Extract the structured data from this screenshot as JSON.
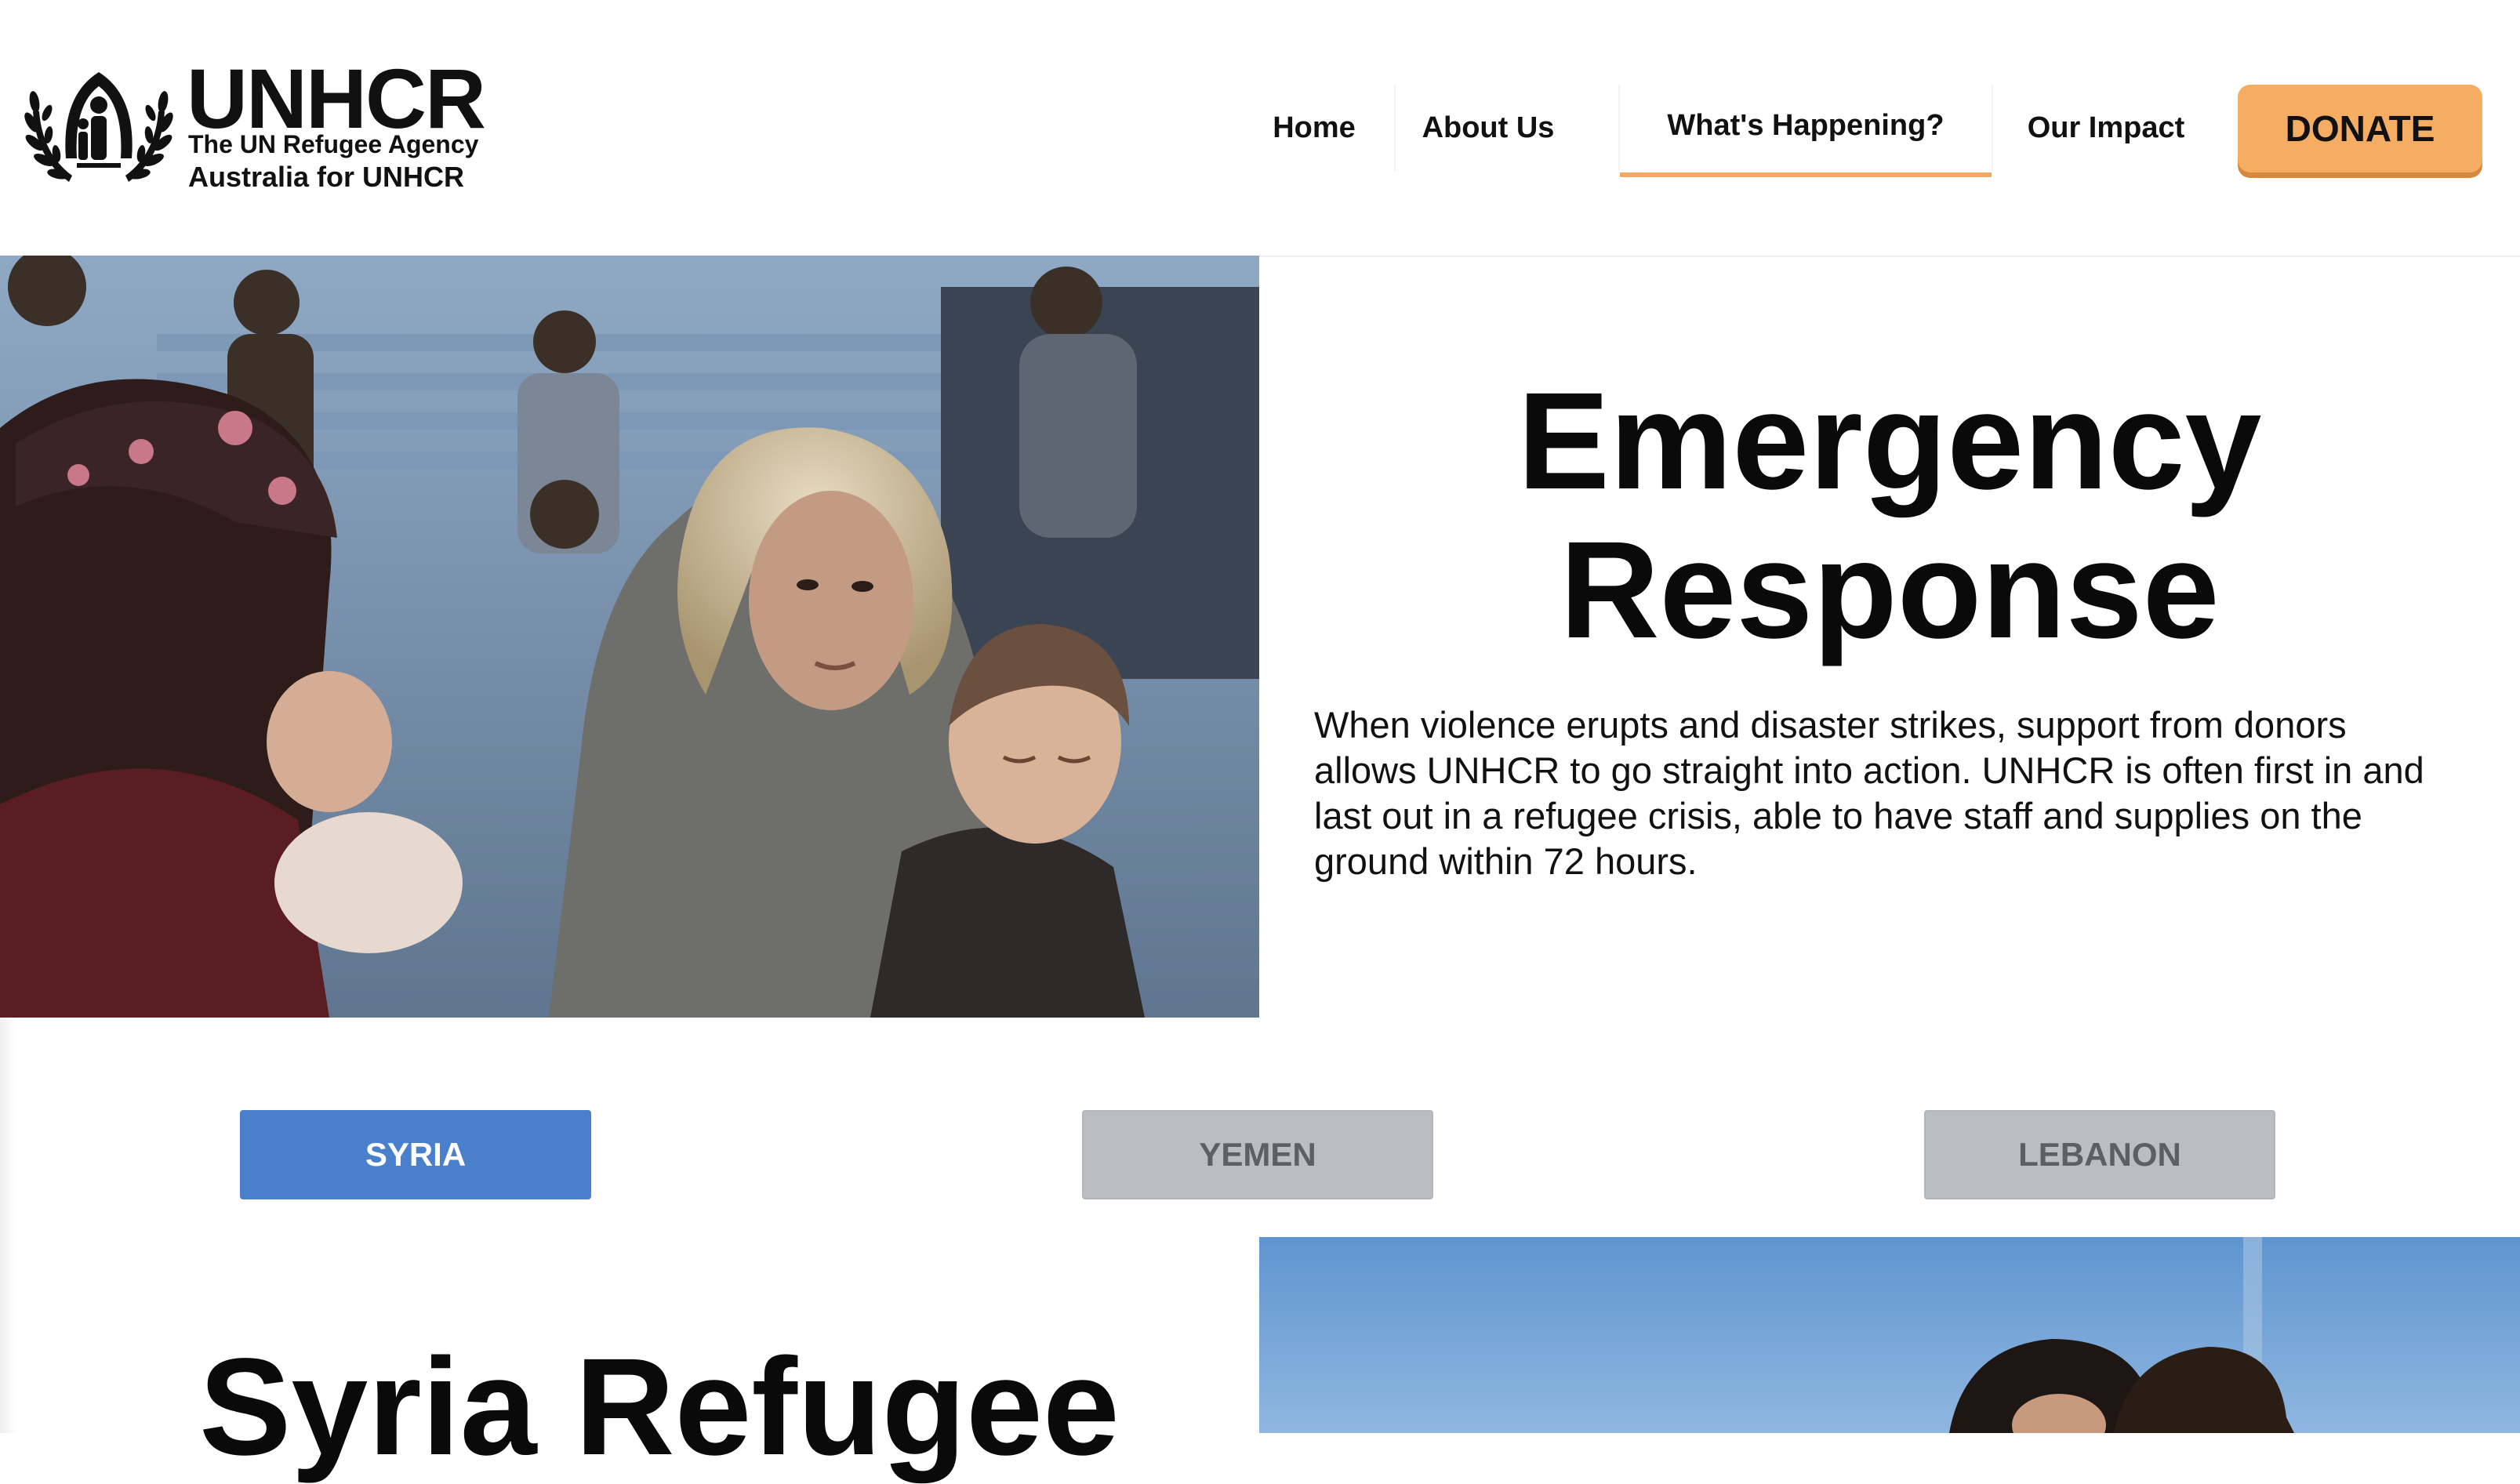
{
  "header": {
    "logo": {
      "wordmark": "UNHCR",
      "tagline": "The UN Refugee Agency",
      "subtitle": "Australia for UNHCR"
    },
    "nav": [
      {
        "label": "Home",
        "active": false
      },
      {
        "label": "About Us",
        "active": false
      },
      {
        "label": "What's Happening?",
        "active": true
      },
      {
        "label": "Our Impact",
        "active": false
      }
    ],
    "donate_label": "DONATE"
  },
  "hero": {
    "title_line1": "Emergency",
    "title_line2": "Response",
    "body": "When violence erupts and disaster strikes, support from donors allows UNHCR to go straight into action. UNHCR is often first in and last out in a refugee crisis, able to have staff and supplies on the ground within 72 hours."
  },
  "tabs": [
    {
      "label": "SYRIA",
      "selected": true
    },
    {
      "label": "YEMEN",
      "selected": false
    },
    {
      "label": "LEBANON",
      "selected": false
    }
  ],
  "section": {
    "title": "Syria Refugee"
  },
  "colors": {
    "accent_orange": "#f4ad62",
    "active_tab_blue": "#4a7fcb",
    "inactive_tab_gray": "#babec3",
    "text_dark": "#111111"
  },
  "icons": {
    "logo_emblem": "unhcr-family-laurel-emblem"
  }
}
